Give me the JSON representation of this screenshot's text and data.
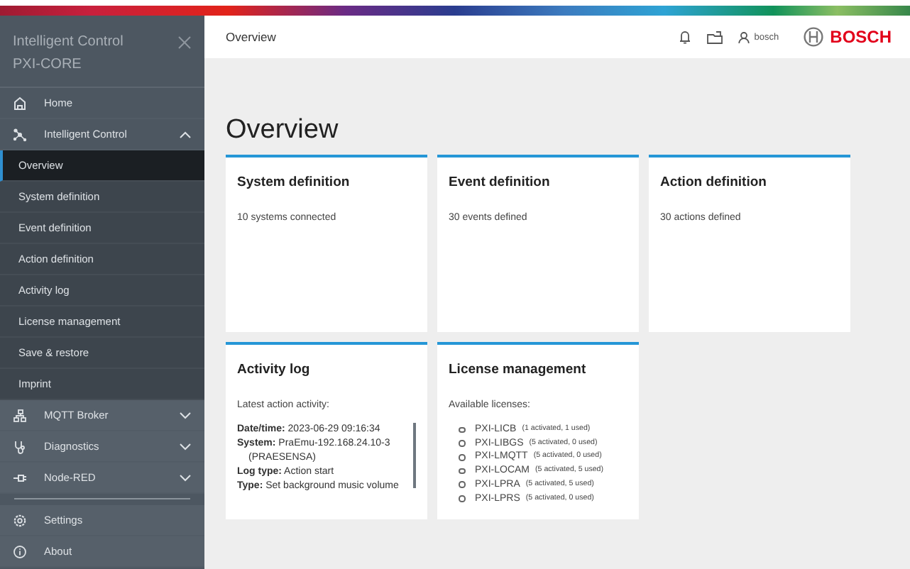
{
  "sidebar": {
    "title": "Intelligent Control",
    "subtitle": "PXI-CORE",
    "items": [
      {
        "label": "Home"
      },
      {
        "label": "Intelligent Control",
        "expanded": true,
        "children": [
          {
            "label": "Overview",
            "selected": true
          },
          {
            "label": "System definition",
            "selected": false
          },
          {
            "label": "Event definition",
            "selected": false
          },
          {
            "label": "Action definition",
            "selected": false
          },
          {
            "label": "Activity log",
            "selected": false
          },
          {
            "label": "License management",
            "selected": false
          },
          {
            "label": "Save & restore",
            "selected": false
          },
          {
            "label": "Imprint",
            "selected": false
          }
        ]
      },
      {
        "label": "MQTT Broker",
        "expanded": false
      },
      {
        "label": "Diagnostics",
        "expanded": false
      },
      {
        "label": "Node-RED",
        "expanded": false
      }
    ],
    "footer_items": [
      {
        "label": "Settings"
      },
      {
        "label": "About"
      }
    ]
  },
  "header": {
    "breadcrumb": "Overview",
    "user": "bosch",
    "brand": "BOSCH"
  },
  "page_title": "Overview",
  "cards": [
    {
      "kind": "text",
      "title": "System definition",
      "text": "10 systems connected"
    },
    {
      "kind": "text",
      "title": "Event definition",
      "text": "30 events defined"
    },
    {
      "kind": "text",
      "title": "Action definition",
      "text": "30 actions defined"
    },
    {
      "kind": "activity",
      "title": "Activity log",
      "intro": "Latest action activity:",
      "entries": [
        "**Date/time:** 2023-06-29 09:16:34",
        "**System:** PraEmu-192.168.24.10-3 (PRAESENSA)",
        "**Log type:** Action start",
        "**Type:** Set background music volume"
      ]
    },
    {
      "kind": "licenses",
      "title": "License management",
      "intro": "Available licenses:",
      "licenses": [
        {
          "name": "PXI-LICB",
          "detail": "(1 activated, 1 used)"
        },
        {
          "name": "PXI-LIBGS",
          "detail": "(5 activated, 0 used)"
        },
        {
          "name": "PXI-LMQTT",
          "detail": "(5 activated, 0 used)"
        },
        {
          "name": "PXI-LOCAM",
          "detail": "(5 activated, 5 used)"
        },
        {
          "name": "PXI-LPRA",
          "detail": "(5 activated, 5 used)"
        },
        {
          "name": "PXI-LPRS",
          "detail": "(5 activated, 0 used)"
        }
      ]
    }
  ]
}
